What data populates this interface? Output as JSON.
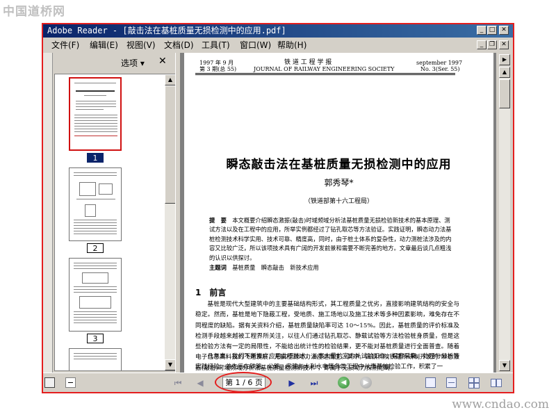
{
  "watermarks": {
    "top": "中国道桥网",
    "bottom": "www.cndao.com"
  },
  "window": {
    "title": "Adobe Reader - [敲击法在基桩质量无损检测中的应用.pdf]"
  },
  "menu": {
    "items": [
      "文件(F)",
      "编辑(E)",
      "视图(V)",
      "文档(D)",
      "工具(T)",
      "窗口(W)",
      "帮助(H)"
    ]
  },
  "panel": {
    "options_label": "选项 ▾",
    "close_label": "✕",
    "page_labels": [
      "1",
      "2",
      "3"
    ]
  },
  "document": {
    "header_left_1": "1997 年 9 月",
    "header_left_2": "第 3 期(总 55)",
    "header_center_1": "铁 道 工 程 学 报",
    "header_center_2": "JOURNAL OF RAILWAY ENGINEERING SOCIETY",
    "header_right_1": "september 1997",
    "header_right_2": "No. 3(Ser. 55)",
    "title": "瞬态敲击法在基桩质量无损检测中的应用",
    "author": "郭秀琴*",
    "affiliation": "（铁道部第十六工程局）",
    "abstract_label": "提　要",
    "abstract_text": "本文概要介绍瞬态激振(敲击)时域频域分析法基桩质量无损检验新技术的基本原理、测试方法以及在工程中的应用，所举实例都经过了钻孔取芯等方法验证。实践证明，瞬态动力法基桩检测技术科学实用、技术可靠、精度高，同时，由于桩土体系的复杂性，动力测桩法涉及的内容又比较广泛，所以该项技术具有广阔的开发前景和需要不断完善的地方。文章最后谈几点粗浅的认识以供探讨。",
    "keywords_label": "主题词",
    "keywords": "基桩质量　瞬态敲击　新技术应用",
    "section_heading": "1　前言",
    "paragraph_1": "基桩是现代大型建筑中的主要基础结构形式，其工程质量之优劣，直接影响建筑结构的安全与稳定。然而，基桩是地下隐蔽工程，受地质、施工场地以及施工技术等多种因素影响，难免存在不同程度的缺陷。据有关资料介绍，基桩质量缺陷率可达 10～15%。因此，基桩质量的评价标准及检测手段越来越被工程界所关注，以往人们通过钻孔取芯、静载试验等方法检验桩身质量，但是这些检验方法有一定的局限性，不能给出统计性的检验结果，更不能对基桩质量进行全面普查。随着电子信息高科技的飞速发展，无损检测动力法应运而生。其中，由铁科院铁建所研制开发的“瞬态激振(敲击)时域频域分析法基桩质量检测新技术”，即属于无损动力探测范畴。",
    "paragraph_2": "几年来，我们不断推广应用此项技术，从事大量的室内外试验工作，探索采集、处理与分析等实践经验；曾先后在铁路、公路、房建与水利水电等各类工程中从事基桩检验工作，积累了一"
  },
  "navigation": {
    "page_indicator": "第 1 / 6 页"
  },
  "colors": {
    "annotation_red": "#e41e1e",
    "title_bar": "#0a246a",
    "selected_page": "#0a246a"
  }
}
